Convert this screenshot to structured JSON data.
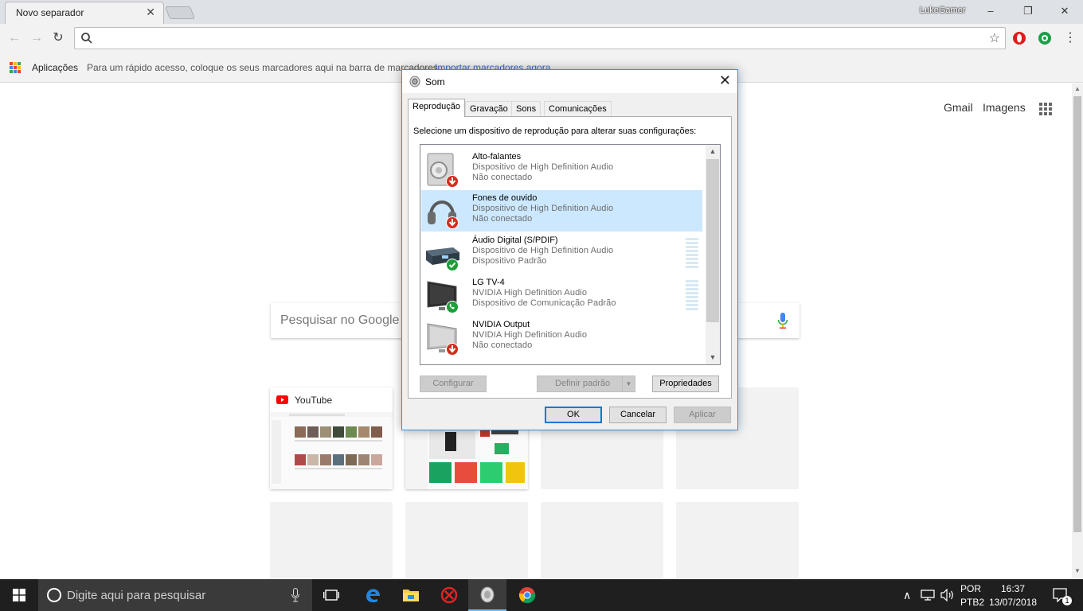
{
  "browser": {
    "tab_title": "Novo separador",
    "profile_name": "LukeGamer",
    "address_value": "",
    "bookmarks_bar": {
      "apps_label": "Aplicações",
      "hint": "Para um rápido acesso, coloque os seus marcadores aqui na barra de marcadores.",
      "import_link": "Importar marcadores agora..."
    }
  },
  "new_tab_page": {
    "links": {
      "gmail": "Gmail",
      "images": "Imagens"
    },
    "search_placeholder": "Pesquisar no Google ou escrever URL",
    "tiles": [
      {
        "title": "YouTube"
      },
      {
        "title": ""
      }
    ]
  },
  "dialog": {
    "title": "Som",
    "tabs": [
      "Reprodução",
      "Gravação",
      "Sons",
      "Comunicações"
    ],
    "instruction": "Selecione um dispositivo de reprodução para alterar suas configurações:",
    "devices": [
      {
        "name": "Alto-falantes",
        "driver": "Dispositivo de High Definition Audio",
        "status": "Não conectado",
        "badge": "red-down-arrow",
        "icon": "speaker-icon"
      },
      {
        "name": "Fones de ouvido",
        "driver": "Dispositivo de High Definition Audio",
        "status": "Não conectado",
        "badge": "red-down-arrow",
        "icon": "headphones-icon"
      },
      {
        "name": "Áudio Digital (S/PDIF)",
        "driver": "Dispositivo de High Definition Audio",
        "status": "Dispositivo Padrão",
        "badge": "green-check",
        "icon": "digital-audio-icon"
      },
      {
        "name": "LG TV-4",
        "driver": "NVIDIA High Definition Audio",
        "status": "Dispositivo de Comunicação Padrão",
        "badge": "green-phone",
        "icon": "tv-icon"
      },
      {
        "name": "NVIDIA Output",
        "driver": "NVIDIA High Definition Audio",
        "status": "Não conectado",
        "badge": "red-down-arrow",
        "icon": "monitor-icon"
      }
    ],
    "buttons": {
      "configure": "Configurar",
      "set_default": "Definir padrão",
      "properties": "Propriedades",
      "ok": "OK",
      "cancel": "Cancelar",
      "apply": "Aplicar"
    }
  },
  "taskbar": {
    "search_placeholder": "Digite aqui para pesquisar",
    "language": "POR",
    "layout": "PTB2",
    "time": "16:37",
    "date": "13/07/2018",
    "notification_count": "1"
  },
  "colors": {
    "selection": "#cce8ff",
    "accent": "#0078d7",
    "taskbar": "#1f1f1f",
    "link": "#3367d6"
  }
}
